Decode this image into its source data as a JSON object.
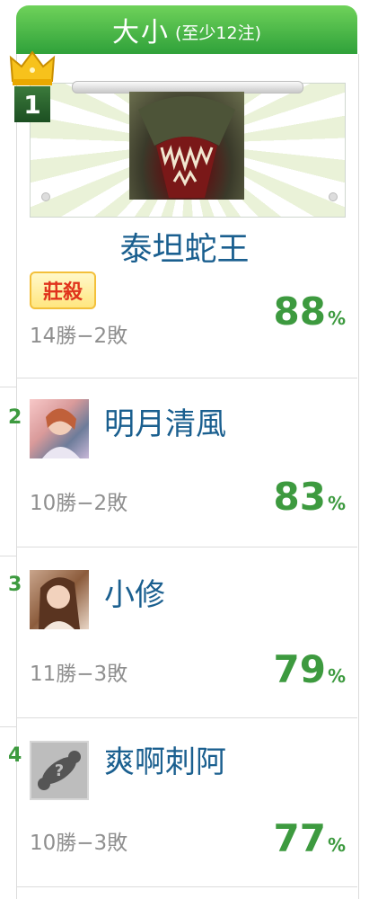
{
  "header": {
    "title": "大小",
    "subtitle": "(至少12注)"
  },
  "colors": {
    "header_green": "#2fa13a",
    "percent_green": "#3d9a3f",
    "name_blue": "#1a5f8f",
    "badge_red": "#e0331c"
  },
  "entries": [
    {
      "rank": "1",
      "name": "泰坦蛇王",
      "badge": "莊殺",
      "record": "14勝−2敗",
      "percent": "88",
      "unit": "%"
    },
    {
      "rank": "2",
      "name": "明月清風",
      "record": "10勝−2敗",
      "percent": "83",
      "unit": "%"
    },
    {
      "rank": "3",
      "name": "小修",
      "record": "11勝−3敗",
      "percent": "79",
      "unit": "%"
    },
    {
      "rank": "4",
      "name": "爽啊刺阿",
      "record": "10勝−3敗",
      "percent": "77",
      "unit": "%"
    }
  ],
  "icons": {
    "crown": "crown-icon",
    "default_avatar": "question-avatar-icon"
  }
}
